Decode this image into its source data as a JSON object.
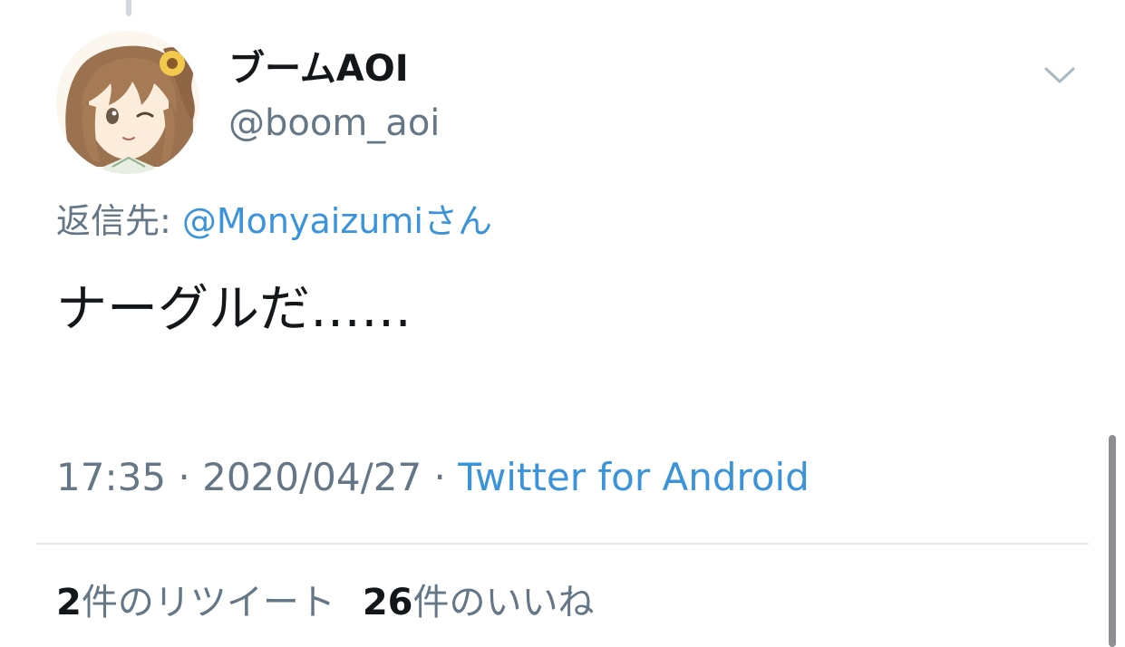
{
  "tweet": {
    "display_name": "ブームAOI",
    "handle": "@boom_aoi",
    "reply_prefix": "返信先: ",
    "reply_to": "@Monyaizumiさん",
    "text": "ナーグルだ……",
    "time": "17:35",
    "separator": " · ",
    "date": "2020/04/27",
    "source": "Twitter for Android",
    "retweet_count": "2",
    "retweet_label": "件のリツイート",
    "like_count": "26",
    "like_label": "件のいいね"
  },
  "icons": {
    "menu": "chevron-down-icon",
    "avatar": "anime-avatar"
  },
  "colors": {
    "link": "#3b94d9",
    "secondary_text": "#657786",
    "primary_text": "#14171a",
    "divider": "#e1e8ed"
  }
}
